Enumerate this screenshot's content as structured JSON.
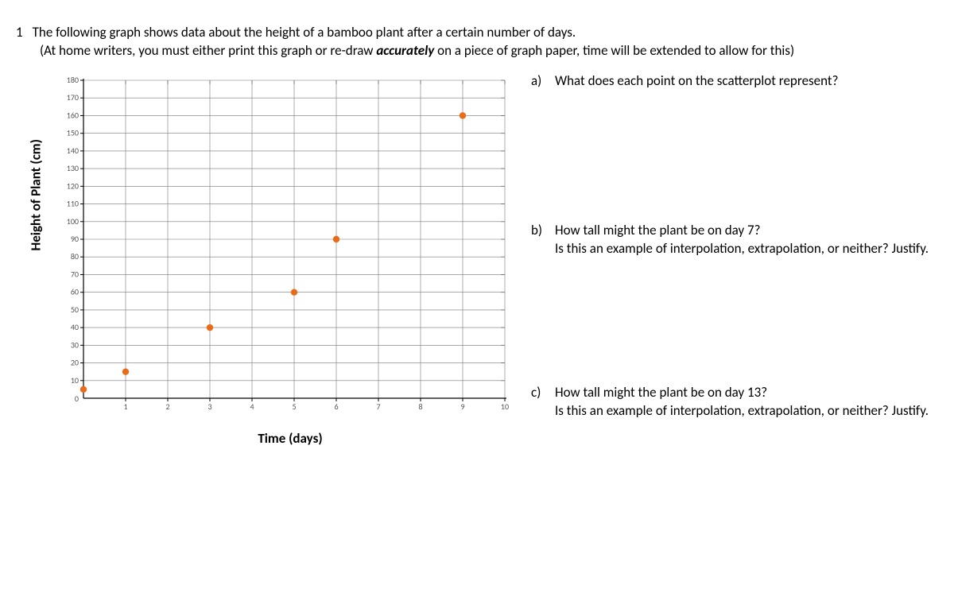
{
  "question_number": "1",
  "question_text": "The following graph shows data about the height of a bamboo plant after a certain number of days.",
  "note_line1": "(At home writers, you must either print this graph or re-draw ",
  "note_em": "accurately",
  "note_line2": " on a piece of graph paper, time will be extended to allow for this)",
  "yaxis": "Height of Plant (cm)",
  "xaxis": "Time (days)",
  "sub": {
    "a": {
      "letter": "a)",
      "text": "What does each point on the scatterplot represent?"
    },
    "b": {
      "letter": "b)",
      "text": "How tall might the plant be on day 7?",
      "line2": "Is this an example of interpolation, extrapolation, or neither? Justify."
    },
    "c": {
      "letter": "c)",
      "text": "How tall might the plant be on day 13?",
      "line2": "Is this an example of interpolation, extrapolation, or neither? Justify."
    }
  },
  "chart_data": {
    "type": "scatter",
    "title": "",
    "xlabel": "Time (days)",
    "ylabel": "Height of Plant (cm)",
    "xlim": [
      0,
      10
    ],
    "ylim": [
      0,
      180
    ],
    "xticks": [
      0,
      1,
      2,
      3,
      4,
      5,
      6,
      7,
      8,
      9,
      10
    ],
    "yticks": [
      0,
      10,
      20,
      30,
      40,
      50,
      60,
      70,
      80,
      90,
      100,
      110,
      120,
      130,
      140,
      150,
      160,
      170,
      180
    ],
    "points": [
      {
        "x": 0,
        "y": 5
      },
      {
        "x": 1,
        "y": 15
      },
      {
        "x": 3,
        "y": 40
      },
      {
        "x": 5,
        "y": 60
      },
      {
        "x": 6,
        "y": 90
      },
      {
        "x": 9,
        "y": 160
      }
    ],
    "point_color": "#e86c1a"
  }
}
